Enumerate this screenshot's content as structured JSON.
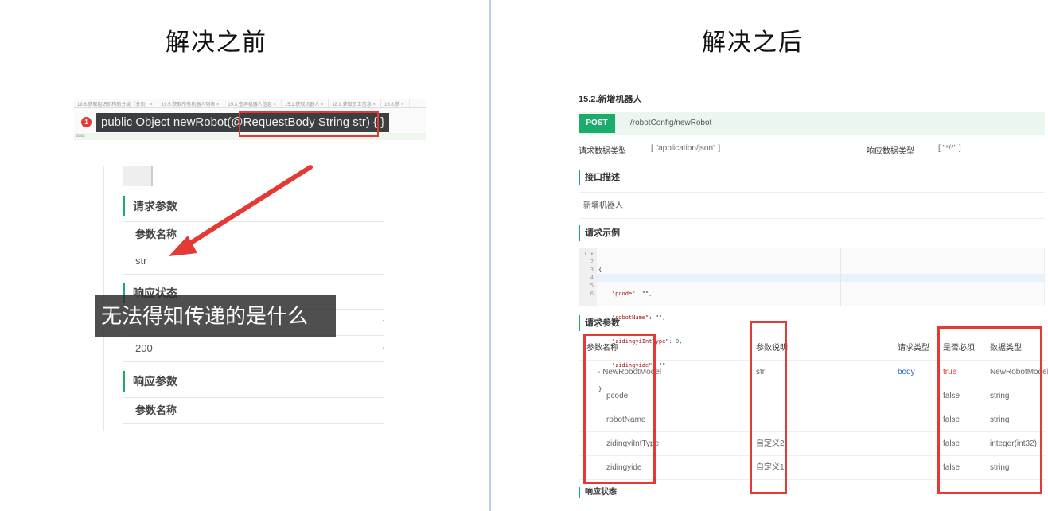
{
  "headings": {
    "before": "解决之前",
    "after": "解决之后"
  },
  "before": {
    "ide": {
      "tabs": [
        "19.6.获取组织机构的分类（分页）×",
        "19.5.获取所有机器人列表 ×",
        "19.3.查询机器人信息 ×",
        "15.1.获取机器人 ×",
        "18.9.获取员工信息 ×",
        "19.8.获 ×"
      ],
      "error_badge": "1",
      "tooltip": "public Object newRobot(@RequestBody String str) { }",
      "bottom_text": "buot"
    },
    "doc": {
      "request_params_title": "请求参数",
      "param_name_header": "参数名称",
      "param_value": "str",
      "response_status_title": "响应状态",
      "status_code": "200",
      "partial_right_1": "说",
      "partial_right_2": "O",
      "response_params_title": "响应参数",
      "response_param_name_header": "参数名称"
    },
    "caption": "无法得知传递的是什么",
    "colors": {
      "red": "#e53935",
      "green": "#1bab6b"
    }
  },
  "after": {
    "api_title": "15.2.新增机器人",
    "method": "POST",
    "path": "/robotConfig/newRobot",
    "request_type_label": "请求数据类型",
    "request_type_value": "[ \"application/json\" ]",
    "response_type_label": "响应数据类型",
    "response_type_value": "[ \"*/*\" ]",
    "desc_title": "接口描述",
    "desc_text": "新增机器人",
    "example_title": "请求示例",
    "code_line_numbers": [
      "1 ▾",
      "2",
      "3",
      "4",
      "5",
      "6"
    ],
    "code": {
      "l1": "{",
      "l2k": "\"pcode\"",
      "l2v": ": \"\",",
      "l3k": "\"robotName\"",
      "l3v": ": \"\",",
      "l4k": "\"zidingyiIntType\"",
      "l4m": ": ",
      "l4n": "0",
      "l4e": ",",
      "l5k": "\"zidingyide\"",
      "l5v": ": \"\"",
      "l6": "}"
    },
    "params_title": "请求参数",
    "table": {
      "headers": {
        "name": "参数名称",
        "desc": "参数说明",
        "type": "请求类型",
        "required": "是否必须",
        "dtype": "数据类型"
      },
      "rows": [
        {
          "name": "- NewRobotModel",
          "desc": "str",
          "type": "body",
          "required": "true",
          "dtype": "NewRobotModel"
        },
        {
          "name": "pcode",
          "desc": "",
          "type": "",
          "required": "false",
          "dtype": "string"
        },
        {
          "name": "robotName",
          "desc": "",
          "type": "",
          "required": "false",
          "dtype": "string"
        },
        {
          "name": "zidingyiIntType",
          "desc": "自定义2",
          "type": "",
          "required": "false",
          "dtype": "integer(int32)"
        },
        {
          "name": "zidingyide",
          "desc": "自定义1",
          "type": "",
          "required": "false",
          "dtype": "string"
        }
      ]
    },
    "cut_section": "响应状态"
  }
}
